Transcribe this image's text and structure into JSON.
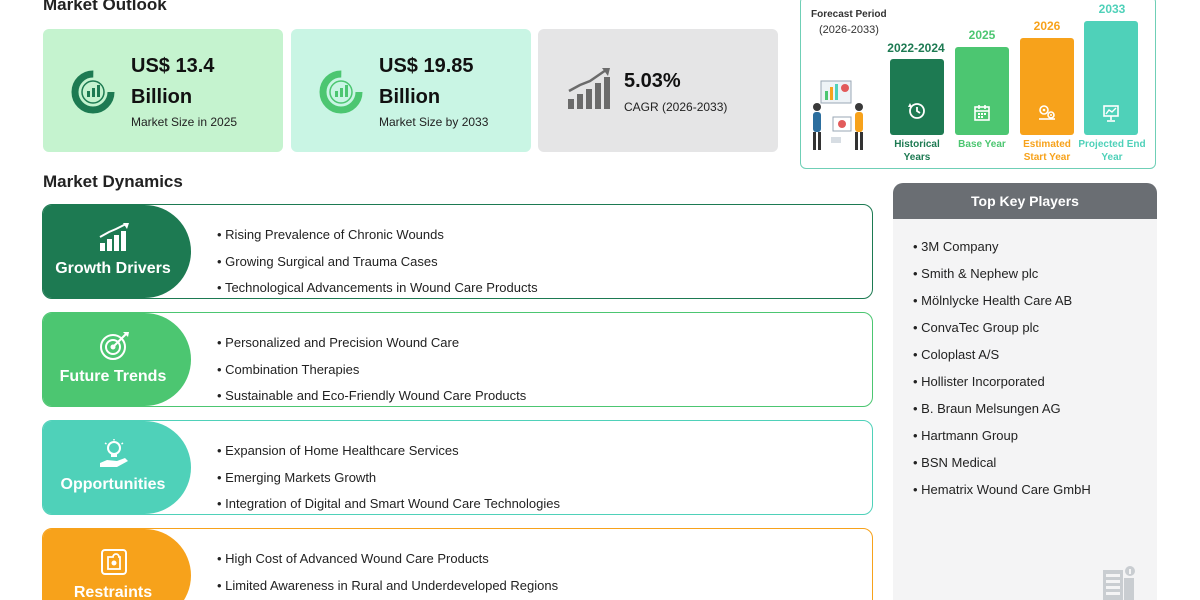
{
  "outlook": {
    "title": "Market Outlook",
    "cards": [
      {
        "value": "US$ 13.4 Billion",
        "label": "Market Size in 2025"
      },
      {
        "value": "US$ 19.85 Billion",
        "label": "Market Size by 2033"
      },
      {
        "value": "5.03%",
        "label": "CAGR (2026-2033)"
      }
    ]
  },
  "forecast": {
    "title": "Forecast Period",
    "range": "(2026-2033)",
    "bars": [
      {
        "year": "2022-2024",
        "caption": "Historical Years",
        "color": "#1d7a52"
      },
      {
        "year": "2025",
        "caption": "Base Year",
        "color": "#4cc671"
      },
      {
        "year": "2026",
        "caption": "Estimated Start Year",
        "color": "#f7a21b"
      },
      {
        "year": "2033",
        "caption": "Projected End Year",
        "color": "#4fd1b9"
      }
    ]
  },
  "dynamics": {
    "title": "Market Dynamics",
    "sections": [
      {
        "label": "Growth Drivers",
        "color": "#1d7a52",
        "items": [
          "Rising Prevalence of Chronic Wounds",
          "Growing Surgical and Trauma Cases",
          "Technological Advancements in Wound Care Products"
        ]
      },
      {
        "label": "Future Trends",
        "color": "#4cc671",
        "items": [
          "Personalized and Precision Wound Care",
          "Combination Therapies",
          "Sustainable and Eco-Friendly Wound Care Products"
        ]
      },
      {
        "label": "Opportunities",
        "color": "#4fd1b9",
        "items": [
          "Expansion of Home Healthcare Services",
          "Emerging Markets Growth",
          "Integration of Digital and Smart Wound Care Technologies"
        ]
      },
      {
        "label": "Restraints",
        "color": "#f7a21b",
        "items": [
          "High Cost of Advanced Wound Care Products",
          "Limited Awareness in Rural and Underdeveloped Regions"
        ]
      }
    ]
  },
  "players": {
    "title": "Top Key Players",
    "items": [
      "3M Company",
      "Smith & Nephew plc",
      "Mölnlycke Health Care AB",
      "ConvaTec Group plc",
      "Coloplast A/S",
      "Hollister Incorporated",
      "B. Braun Melsungen AG",
      "Hartmann Group",
      "BSN Medical",
      "Hematrix Wound Care GmbH"
    ]
  },
  "colors": {
    "dark_green": "#1d7a52",
    "green": "#4cc671",
    "teal": "#4fd1b9",
    "orange": "#f7a21b",
    "card_green": "#c5f3cf",
    "card_mint": "#c9f5e4",
    "card_gray": "#e5e5e6",
    "header_gray": "#6a6e73"
  },
  "icons": [
    "donut-chart-icon",
    "rising-bar-chart-icon",
    "history-clock-icon",
    "calendar-icon",
    "gears-icon",
    "presentation-board-icon",
    "growth-chart-icon",
    "target-icon",
    "lightbulb-hand-icon",
    "puzzle-icon",
    "building-icon"
  ]
}
